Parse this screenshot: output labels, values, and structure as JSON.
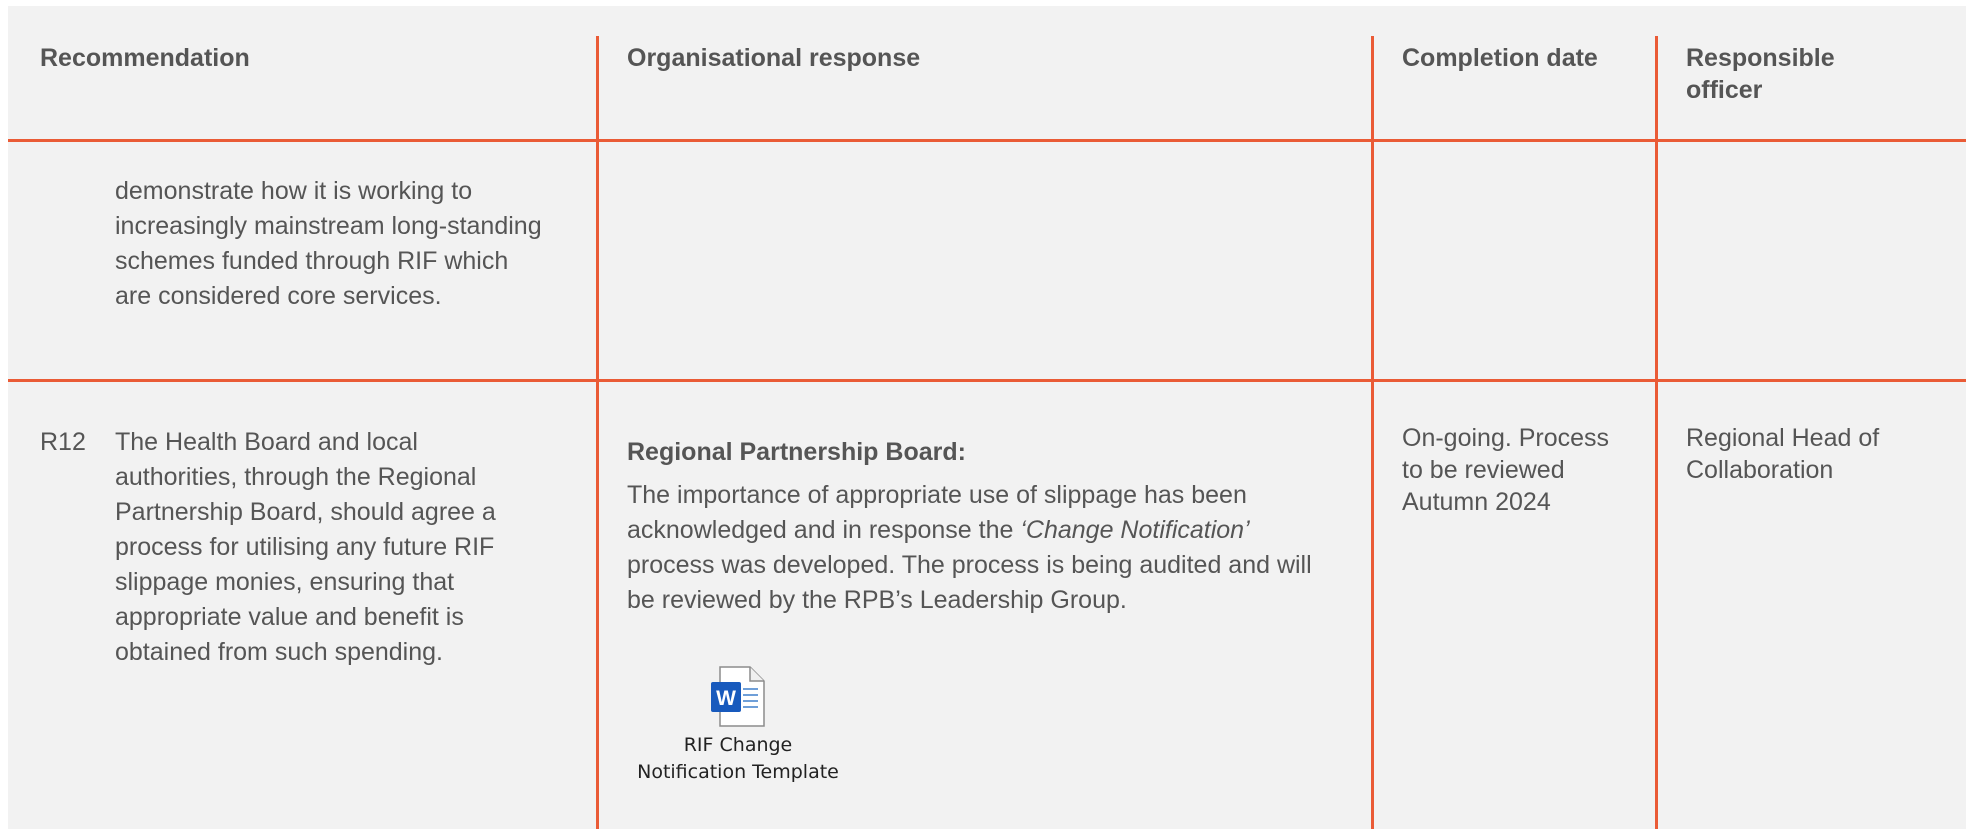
{
  "table": {
    "headers": {
      "recommendation": "Recommendation",
      "response": "Organisational response",
      "completion": "Completion date",
      "officer": "Responsible officer"
    },
    "rows": [
      {
        "id": "",
        "recommendation": "demonstrate how it is working to increasingly mainstream long-standing schemes funded through RIF which are considered core services.",
        "response_heading": "",
        "response_before": "",
        "response_italic": "",
        "response_after": "",
        "completion": "",
        "officer": ""
      },
      {
        "id": "R12",
        "recommendation": "The Health Board and local authorities, through the Regional Partnership Board, should agree a process for utilising any future RIF slippage monies, ensuring that appropriate value and benefit is obtained from such spending.",
        "response_heading": "Regional Partnership Board:",
        "response_before": "The importance of appropriate use of slippage has been acknowledged and in response the ",
        "response_italic": "‘Change Notification’",
        "response_after": " process was developed. The process is being audited and will be reviewed by the RPB’s Leadership Group.",
        "completion": "On-going. Process to be reviewed Autumn 2024",
        "officer": "Regional Head of Collaboration"
      }
    ],
    "attachment": {
      "icon": "word-document-icon",
      "label": "RIF Change Notification Template",
      "icon_color": "#185abd"
    }
  },
  "colors": {
    "rule": "#ea5b36",
    "background": "#f2f2f2",
    "text": "#555555"
  }
}
